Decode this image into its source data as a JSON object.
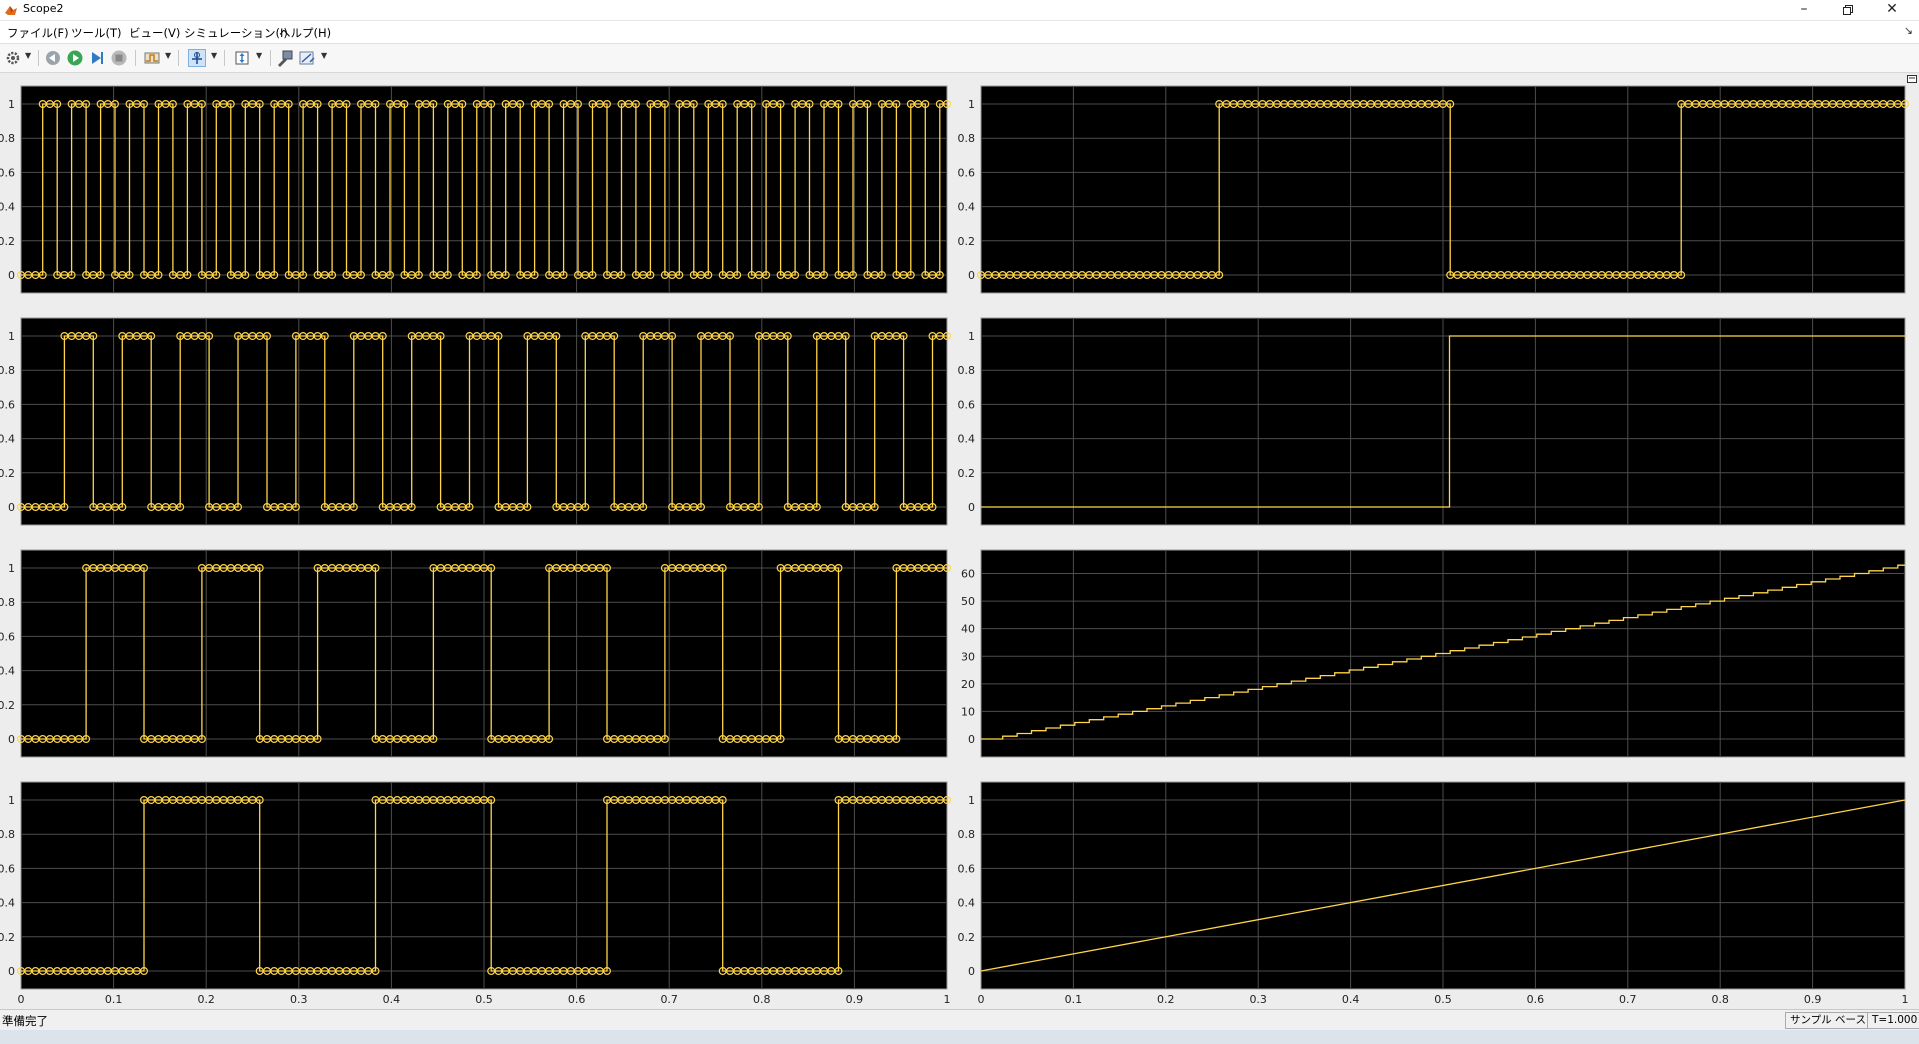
{
  "window": {
    "title": "Scope2",
    "controls": [
      "minimize-icon",
      "restore-icon",
      "close-icon"
    ]
  },
  "menu": {
    "items": [
      "ファイル(F)",
      "ツール(T)",
      "ビュー(V)",
      "シミュレーション(I)",
      "ヘルプ(H)"
    ]
  },
  "toolbar": {
    "icons": [
      "settings-gear-icon",
      "step-back-icon",
      "run-icon",
      "step-forward-icon",
      "stop-icon",
      "triggers-icon",
      "zoom-pan-icon",
      "scale-axes-icon",
      "highlight-block-icon",
      "measurements-icon"
    ]
  },
  "colors": {
    "plot_background": "#000000",
    "grid": "#4d4d4d",
    "trace": "#ffd54a",
    "axis_tick_text": "#222222"
  },
  "chart_data": [
    {
      "type": "line",
      "step": true,
      "markers": true,
      "xlim": [
        0,
        1
      ],
      "ylim": [
        0,
        1
      ],
      "yticks": [
        0,
        0.2,
        0.4,
        0.6,
        0.8,
        1
      ],
      "yticklabels": [
        "0",
        "0.2",
        "0.4",
        "0.6",
        "0.8",
        "1"
      ],
      "period": 0.03125,
      "duty": 0.5,
      "phase": 0.0234375,
      "grid": true
    },
    {
      "type": "line",
      "step": true,
      "markers": true,
      "xlim": [
        0,
        1
      ],
      "ylim": [
        0,
        1
      ],
      "yticks": [
        0,
        0.2,
        0.4,
        0.6,
        0.8,
        1
      ],
      "yticklabels": [
        "0",
        "0.2",
        "0.4",
        "0.6",
        "0.8",
        "1"
      ],
      "period": 0.0625,
      "duty": 0.5,
      "phase": 0.046875,
      "grid": true
    },
    {
      "type": "line",
      "step": true,
      "markers": true,
      "xlim": [
        0,
        1
      ],
      "ylim": [
        0,
        1
      ],
      "yticks": [
        0,
        0.2,
        0.4,
        0.6,
        0.8,
        1
      ],
      "yticklabels": [
        "0",
        "0.2",
        "0.4",
        "0.6",
        "0.8",
        "1"
      ],
      "period": 0.125,
      "duty": 0.5,
      "phase": 0.0703125,
      "grid": true
    },
    {
      "type": "line",
      "step": true,
      "markers": true,
      "xlim": [
        0,
        1
      ],
      "ylim": [
        0,
        1
      ],
      "yticks": [
        0,
        0.2,
        0.4,
        0.6,
        0.8,
        1
      ],
      "yticklabels": [
        "0",
        "0.2",
        "0.4",
        "0.6",
        "0.8",
        "1"
      ],
      "xticks": [
        0,
        0.1,
        0.2,
        0.3,
        0.4,
        0.5,
        0.6,
        0.7,
        0.8,
        0.9,
        1
      ],
      "xticklabels": [
        "0",
        "0.1",
        "0.2",
        "0.3",
        "0.4",
        "0.5",
        "0.6",
        "0.7",
        "0.8",
        "0.9",
        "1"
      ],
      "period": 0.25,
      "duty": 0.5,
      "phase": 0.1328125,
      "grid": true
    },
    {
      "type": "line",
      "step": true,
      "markers": true,
      "xlim": [
        0,
        1
      ],
      "ylim": [
        0,
        1
      ],
      "yticks": [
        0,
        0.2,
        0.4,
        0.6,
        0.8,
        1
      ],
      "yticklabels": [
        "0",
        "0.2",
        "0.4",
        "0.6",
        "0.8",
        "1"
      ],
      "period": 0.5,
      "duty": 0.5,
      "phase": 0.2578125,
      "grid": true
    },
    {
      "type": "line",
      "step": true,
      "markers": false,
      "xlim": [
        0,
        1
      ],
      "ylim": [
        0,
        1
      ],
      "yticks": [
        0,
        0.2,
        0.4,
        0.6,
        0.8,
        1
      ],
      "yticklabels": [
        "0",
        "0.2",
        "0.4",
        "0.6",
        "0.8",
        "1"
      ],
      "x": [
        0,
        0.507,
        0.507,
        1
      ],
      "y": [
        0,
        0,
        1,
        1
      ],
      "grid": true
    },
    {
      "type": "line",
      "step": true,
      "markers": false,
      "xlim": [
        0,
        1
      ],
      "ylim": [
        0,
        62
      ],
      "yticks": [
        0,
        10,
        20,
        30,
        40,
        50,
        60
      ],
      "yticklabels": [
        "0",
        "10",
        "20",
        "30",
        "40",
        "50",
        "60"
      ],
      "staircase": {
        "step_x": 0.015625,
        "start_x": 0.0234375,
        "max": 63
      },
      "grid": true
    },
    {
      "type": "line",
      "step": false,
      "markers": false,
      "xlim": [
        0,
        1
      ],
      "ylim": [
        0,
        1
      ],
      "yticks": [
        0,
        0.2,
        0.4,
        0.6,
        0.8,
        1
      ],
      "yticklabels": [
        "0",
        "0.2",
        "0.4",
        "0.6",
        "0.8",
        "1"
      ],
      "xticks": [
        0,
        0.1,
        0.2,
        0.3,
        0.4,
        0.5,
        0.6,
        0.7,
        0.8,
        0.9,
        1
      ],
      "xticklabels": [
        "0",
        "0.1",
        "0.2",
        "0.3",
        "0.4",
        "0.5",
        "0.6",
        "0.7",
        "0.8",
        "0.9",
        "1"
      ],
      "x": [
        0,
        1
      ],
      "y": [
        0,
        1
      ],
      "grid": true
    }
  ],
  "status": {
    "text": "準備完了",
    "mode": "サンプル ベース",
    "time": "T=1.000"
  }
}
